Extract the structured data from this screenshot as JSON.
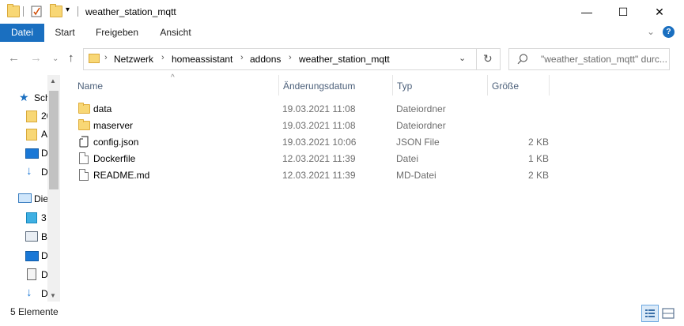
{
  "window": {
    "title": "weather_station_mqtt",
    "minimize": "—",
    "maximize": "☐",
    "close": "✕"
  },
  "ribbon": {
    "tabs": [
      "Datei",
      "Start",
      "Freigeben",
      "Ansicht"
    ]
  },
  "address": {
    "crumbs": [
      "Netzwerk",
      "homeassistant",
      "addons",
      "weather_station_mqtt"
    ],
    "search_placeholder": "\"weather_station_mqtt\" durc..."
  },
  "navpane": {
    "items": [
      {
        "label": "Sch",
        "icon": "star-icon"
      },
      {
        "label": "20",
        "icon": "folder-icon"
      },
      {
        "label": "A",
        "icon": "folder-icon"
      },
      {
        "label": "D",
        "icon": "desktop-icon"
      },
      {
        "label": "D",
        "icon": "download-icon"
      },
      {
        "label": "Die",
        "icon": "computer-icon"
      },
      {
        "label": "3",
        "icon": "3d-objects-icon"
      },
      {
        "label": "B",
        "icon": "pictures-icon"
      },
      {
        "label": "D",
        "icon": "desktop-icon"
      },
      {
        "label": "D",
        "icon": "documents-icon"
      },
      {
        "label": "D",
        "icon": "download-icon"
      }
    ]
  },
  "filelist": {
    "columns": {
      "name": "Name",
      "date": "Änderungsdatum",
      "type": "Typ",
      "size": "Größe"
    },
    "rows": [
      {
        "name": "data",
        "date": "19.03.2021 11:08",
        "type": "Dateiordner",
        "size": "",
        "icon": "folder-icon"
      },
      {
        "name": "maserver",
        "date": "19.03.2021 11:08",
        "type": "Dateiordner",
        "size": "",
        "icon": "folder-icon"
      },
      {
        "name": "config.json",
        "date": "19.03.2021 10:06",
        "type": "JSON File",
        "size": "2 KB",
        "icon": "json-file-icon"
      },
      {
        "name": "Dockerfile",
        "date": "12.03.2021 11:39",
        "type": "Datei",
        "size": "1 KB",
        "icon": "file-icon"
      },
      {
        "name": "README.md",
        "date": "12.03.2021 11:39",
        "type": "MD-Datei",
        "size": "2 KB",
        "icon": "file-icon"
      }
    ]
  },
  "status": {
    "count": "5 Elemente"
  },
  "colors": {
    "accent": "#1a6fc0",
    "header_text": "#4c607a"
  }
}
